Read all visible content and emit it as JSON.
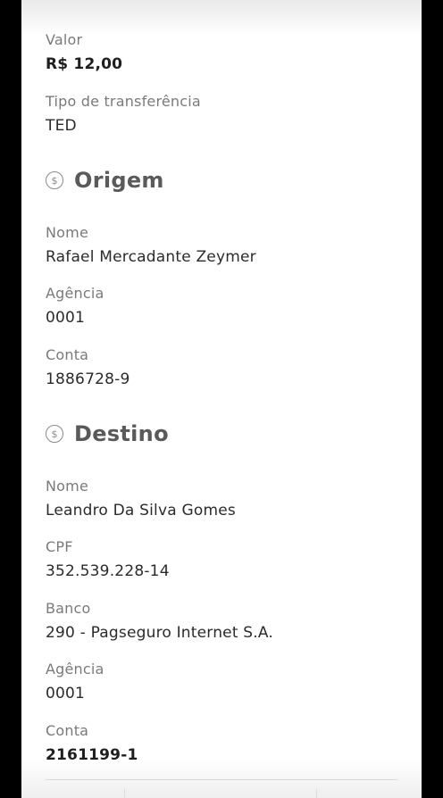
{
  "transfer": {
    "valor_label": "Valor",
    "valor_value": "R$ 12,00",
    "tipo_label": "Tipo de transferência",
    "tipo_value": "TED"
  },
  "origem": {
    "title": "Origem",
    "icon": "dollar-coin-icon",
    "nome_label": "Nome",
    "nome_value": "Rafael Mercadante Zeymer",
    "agencia_label": "Agência",
    "agencia_value": "0001",
    "conta_label": "Conta",
    "conta_value": "1886728-9"
  },
  "destino": {
    "title": "Destino",
    "icon": "dollar-coin-icon",
    "nome_label": "Nome",
    "nome_value": "Leandro Da Silva Gomes",
    "cpf_label": "CPF",
    "cpf_value": "352.539.228-14",
    "banco_label": "Banco",
    "banco_value": "290 - Pagseguro Internet S.A.",
    "agencia_label": "Agência",
    "agencia_value": "0001",
    "conta_label": "Conta",
    "conta_value": "2161199-1"
  }
}
